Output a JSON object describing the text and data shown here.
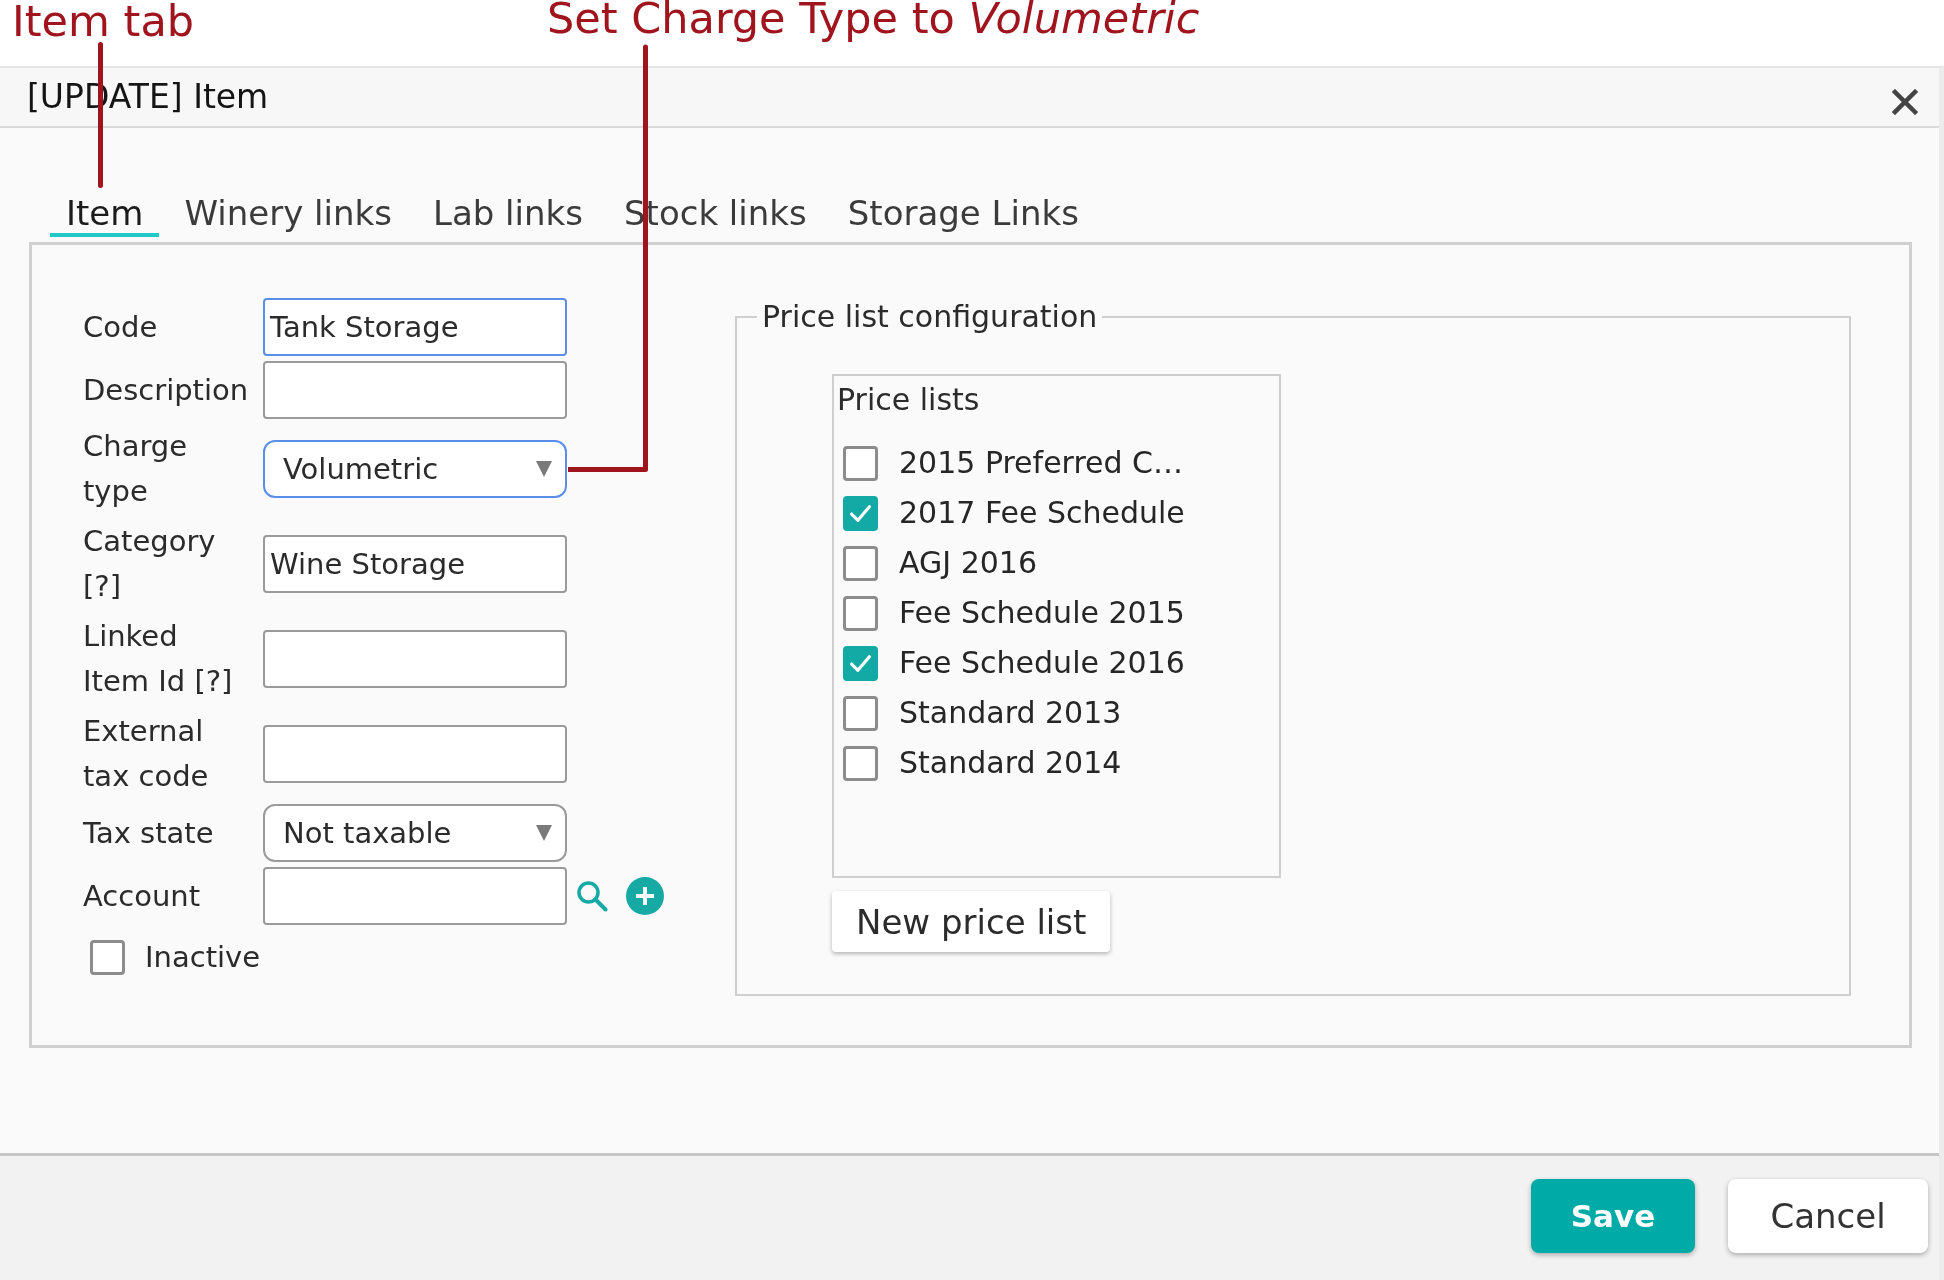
{
  "annotations": [
    {
      "text": "Item tab",
      "kind": "straight"
    },
    {
      "text": "Set Charge Type to *Volumetric*",
      "kind": "elbow"
    }
  ],
  "window": {
    "title": "[UPDATE] Item"
  },
  "tabs": [
    {
      "label": "Item",
      "selected": true
    },
    {
      "label": "Winery links",
      "selected": false
    },
    {
      "label": "Lab links",
      "selected": false
    },
    {
      "label": "Stock links",
      "selected": false
    },
    {
      "label": "Storage Links",
      "selected": false
    }
  ],
  "form": {
    "fields": [
      {
        "label": "Code",
        "kind": "text",
        "value": "Tank Storage",
        "highlighted": true
      },
      {
        "label": "Description",
        "kind": "text",
        "highlighted": false
      },
      {
        "label": "Charge type",
        "kind": "select",
        "value": "Volumetric",
        "highlighted": true
      },
      {
        "label": "Category [?]",
        "kind": "text",
        "value": "Wine Storage",
        "highlighted": false
      },
      {
        "label": "Linked Item Id [?]",
        "kind": "text",
        "highlighted": false
      },
      {
        "label": "External tax code",
        "kind": "text",
        "highlighted": false
      },
      {
        "label": "Tax state",
        "kind": "select",
        "value": "Not taxable",
        "highlighted": false
      },
      {
        "label": "Account",
        "kind": "lookup",
        "highlighted": false
      }
    ],
    "inactive": {
      "label": "Inactive",
      "checked": false
    }
  },
  "price_list_configuration": {
    "legend": "Price list configuration",
    "list_title": "Price lists",
    "items": [
      {
        "label": "2015 Preferred C…",
        "checked": false
      },
      {
        "label": "2017 Fee Schedule",
        "checked": true
      },
      {
        "label": "AGJ 2016",
        "checked": false
      },
      {
        "label": "Fee Schedule 2015",
        "checked": false
      },
      {
        "label": "Fee Schedule 2016",
        "checked": true
      },
      {
        "label": "Standard 2013",
        "checked": false
      },
      {
        "label": "Standard 2014",
        "checked": false
      }
    ],
    "new_button": "New price list"
  },
  "buttons": [
    {
      "label": "Save",
      "kind": "save"
    },
    {
      "label": "Cancel",
      "kind": "cancel"
    }
  ]
}
